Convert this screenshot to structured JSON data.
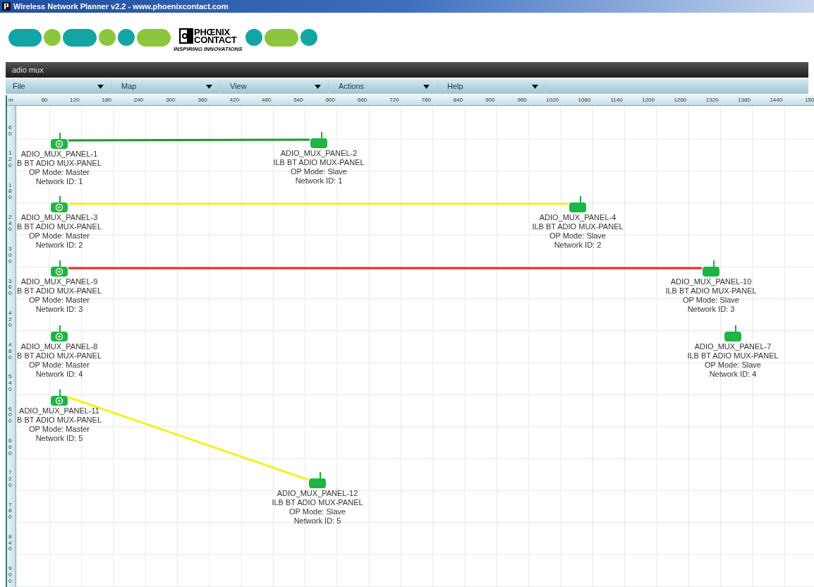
{
  "window": {
    "title": "Wireless Network Planner v2.2 - www.phoenixcontact.com"
  },
  "logo": {
    "line1": "PHŒNIX",
    "line2": "CONTACT",
    "tagline": "INSPIRING INNOVATIONS"
  },
  "document_tab": "adio mux",
  "menus": [
    "File",
    "Map",
    "View",
    "Actions",
    "Help"
  ],
  "ruler": {
    "unit": "m",
    "x_labels": [
      "60",
      "120",
      "180",
      "240",
      "300",
      "360",
      "420",
      "480",
      "540",
      "600",
      "660",
      "720",
      "780",
      "840",
      "900",
      "960",
      "1020",
      "1080",
      "1140",
      "1200",
      "1260",
      "1320",
      "1380",
      "1440",
      "150"
    ],
    "y_labels": [
      "60",
      "120",
      "180",
      "240",
      "300",
      "360",
      "420",
      "480",
      "540",
      "600",
      "660",
      "720",
      "780",
      "840",
      "900"
    ]
  },
  "nodes": [
    {
      "kind": "master",
      "name": "ADIO_MUX_PANEL-1",
      "model": "B BT ADIO MUX-PANEL",
      "mode": "OP Mode: Master",
      "network": "Network ID: 1"
    },
    {
      "kind": "slave",
      "name": "ADIO_MUX_PANEL-2",
      "model": "ILB BT ADIO MUX-PANEL",
      "mode": "OP Mode: Slave",
      "network": "Network ID: 1"
    },
    {
      "kind": "master",
      "name": "ADIO_MUX_PANEL-3",
      "model": "B BT ADIO MUX-PANEL",
      "mode": "OP Mode: Master",
      "network": "Network ID: 2"
    },
    {
      "kind": "slave",
      "name": "ADIO_MUX_PANEL-4",
      "model": "ILB BT ADIO MUX-PANEL",
      "mode": "OP Mode: Slave",
      "network": "Network ID: 2"
    },
    {
      "kind": "master",
      "name": "ADIO_MUX_PANEL-9",
      "model": "B BT ADIO MUX-PANEL",
      "mode": "OP Mode: Master",
      "network": "Network ID: 3"
    },
    {
      "kind": "slave",
      "name": "ADIO_MUX_PANEL-10",
      "model": "ILB BT ADIO MUX-PANEL",
      "mode": "OP Mode: Slave",
      "network": "Network ID: 3"
    },
    {
      "kind": "master",
      "name": "ADIO_MUX_PANEL-8",
      "model": "B BT ADIO MUX-PANEL",
      "mode": "OP Mode: Master",
      "network": "Network ID: 4"
    },
    {
      "kind": "slave",
      "name": "ADIO_MUX_PANEL-7",
      "model": "ILB BT ADIO MUX-PANEL",
      "mode": "OP Mode: Slave",
      "network": "Network ID: 4"
    },
    {
      "kind": "master",
      "name": "ADIO_MUX_PANEL-11",
      "model": "B BT ADIO MUX-PANEL",
      "mode": "OP Mode: Master",
      "network": "Network ID: 5"
    },
    {
      "kind": "slave",
      "name": "ADIO_MUX_PANEL-12",
      "model": "ILB BT ADIO MUX-PANEL",
      "mode": "OP Mode: Slave",
      "network": "Network ID: 5"
    }
  ],
  "links": [
    {
      "color": "#1e9a2a"
    },
    {
      "color": "#f2f21e"
    },
    {
      "color": "#ee2a1a"
    },
    {
      "color": "#f2f21e"
    }
  ]
}
